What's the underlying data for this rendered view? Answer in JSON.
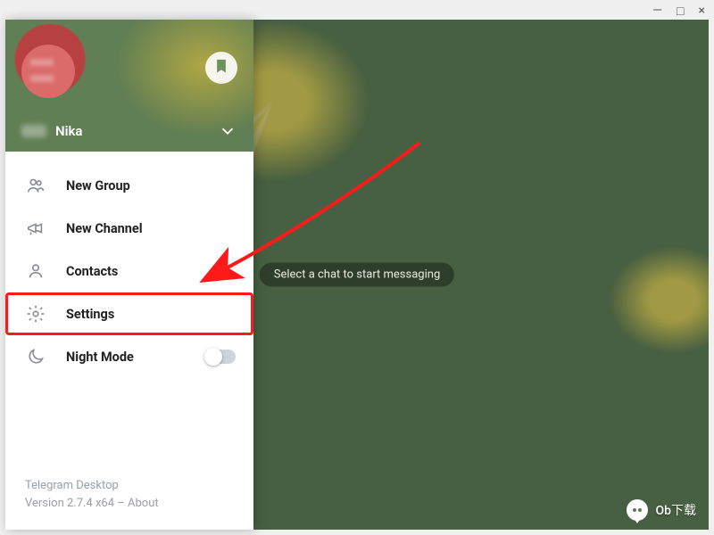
{
  "window": {
    "minimize": "—",
    "maximize": "□",
    "close": "×"
  },
  "profile": {
    "username": "Nika"
  },
  "menu": {
    "new_group": "New Group",
    "new_channel": "New Channel",
    "contacts": "Contacts",
    "settings": "Settings",
    "night_mode": "Night Mode",
    "night_mode_on": false
  },
  "footer": {
    "app_name": "Telegram Desktop",
    "version_line": "Version 2.7.4 x64 – About"
  },
  "main": {
    "placeholder": "Select a chat to start messaging"
  },
  "watermark": {
    "text": "Ob下载"
  },
  "annotation": {
    "highlighted_item": "settings"
  }
}
